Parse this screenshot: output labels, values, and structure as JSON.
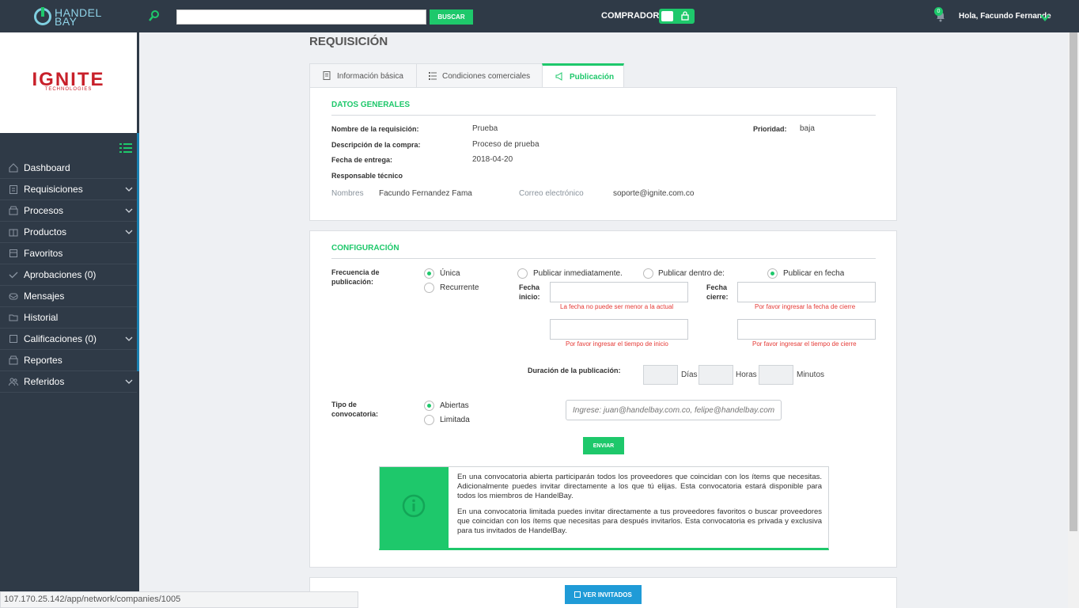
{
  "topbar": {
    "logo_line1": "HANDEL",
    "logo_line2": "BAY",
    "search_placeholder": "",
    "search_button": "BUSCAR",
    "mode_label": "COMPRADOR",
    "notification_count": "0",
    "user_greeting": "Hola, Facundo Fernande"
  },
  "sidebar": {
    "company_name": "IGNITE",
    "company_sub": "TECHNOLOGIES",
    "items": [
      {
        "label": "Dashboard",
        "icon": "home-icon",
        "has_children": false
      },
      {
        "label": "Requisiciones",
        "icon": "clipboard-icon",
        "has_children": true
      },
      {
        "label": "Procesos",
        "icon": "box-icon",
        "has_children": true
      },
      {
        "label": "Productos",
        "icon": "package-icon",
        "has_children": true
      },
      {
        "label": "Favoritos",
        "icon": "bookmark-icon",
        "has_children": false
      },
      {
        "label": "Aprobaciones (0)",
        "icon": "check-icon",
        "has_children": false
      },
      {
        "label": "Mensajes",
        "icon": "mail-icon",
        "has_children": false
      },
      {
        "label": "Historial",
        "icon": "folder-icon",
        "has_children": false
      },
      {
        "label": "Calificaciones (0)",
        "icon": "square-icon",
        "has_children": true
      },
      {
        "label": "Reportes",
        "icon": "report-icon",
        "has_children": false
      },
      {
        "label": "Referidos",
        "icon": "users-icon",
        "has_children": true
      }
    ]
  },
  "page": {
    "title": "REQUISICIÓN",
    "tabs": [
      {
        "label": "Información básica",
        "icon": "document-icon",
        "active": false
      },
      {
        "label": "Condiciones comerciales",
        "icon": "list-icon",
        "active": false
      },
      {
        "label": "Publicación",
        "icon": "megaphone-icon",
        "active": true
      }
    ]
  },
  "general": {
    "section_title": "DATOS GENERALES",
    "name_label": "Nombre de la requisición:",
    "name_value": "Prueba",
    "priority_label": "Prioridad:",
    "priority_value": "baja",
    "description_label": "Descripción de la compra:",
    "description_value": "Proceso de prueba",
    "delivery_label": "Fecha de entrega:",
    "delivery_value": "2018-04-20",
    "tech_label": "Responsable técnico",
    "names_label": "Nombres",
    "names_value": "Facundo Fernandez Fama",
    "email_label": "Correo electrónico",
    "email_value": "soporte@ignite.com.co"
  },
  "config": {
    "section_title": "CONFIGURACIÓN",
    "frequency_label_1": "Frecuencia de",
    "frequency_label_2": "publicación:",
    "frequency_options": [
      {
        "label": "Única",
        "selected": true
      },
      {
        "label": "Recurrente",
        "selected": false
      }
    ],
    "publish_options": [
      {
        "label": "Publicar inmediatamente.",
        "selected": false
      },
      {
        "label": "Publicar dentro de:",
        "selected": false
      },
      {
        "label": "Publicar en fecha",
        "selected": true
      }
    ],
    "start_label_1": "Fecha",
    "start_label_2": "inicio:",
    "end_label_1": "Fecha",
    "end_label_2": "cierre:",
    "start_date_error": "La fecha no puede ser menor a la actual",
    "end_date_error": "Por favor ingresar la fecha de cierre",
    "start_time_error": "Por favor ingresar el tiempo de inicio",
    "end_time_error": "Por favor ingresar el tiempo de cierre",
    "duration_label": "Duración de la publicación:",
    "days_label": "Días",
    "hours_label": "Horas",
    "minutes_label": "Minutos",
    "call_type_label_1": "Tipo de",
    "call_type_label_2": "convocatoria:",
    "call_type_options": [
      {
        "label": "Abiertas",
        "selected": true
      },
      {
        "label": "Limitada",
        "selected": false
      }
    ],
    "emails_placeholder": "Ingrese: juan@handelbay.com.co, felipe@handelbay.com.co",
    "send_button": "ENVIAR",
    "info_paragraph_1": "En una convocatoria abierta participarán todos los proveedores que coincidan con los ítems que necesitas. Adicionalmente puedes invitar directamente a los que tú elijas. Esta convocatoria estará disponible para todos los miembros de HandelBay.",
    "info_paragraph_2": "En una convocatoria limitada puedes invitar directamente a tus proveedores favoritos o buscar proveedores que coincidan con los ítems que necesitas para después invitarlos. Esta convocatoria es privada y exclusiva para tus invitados de HandelBay."
  },
  "invited": {
    "button": "VER INVITADOS"
  },
  "status_url": "107.170.25.142/app/network/companies/1005",
  "colors": {
    "accent": "#1ec86b",
    "topbar": "#2f3a47",
    "error": "#e53935",
    "blue_button": "#1f9bd7"
  }
}
